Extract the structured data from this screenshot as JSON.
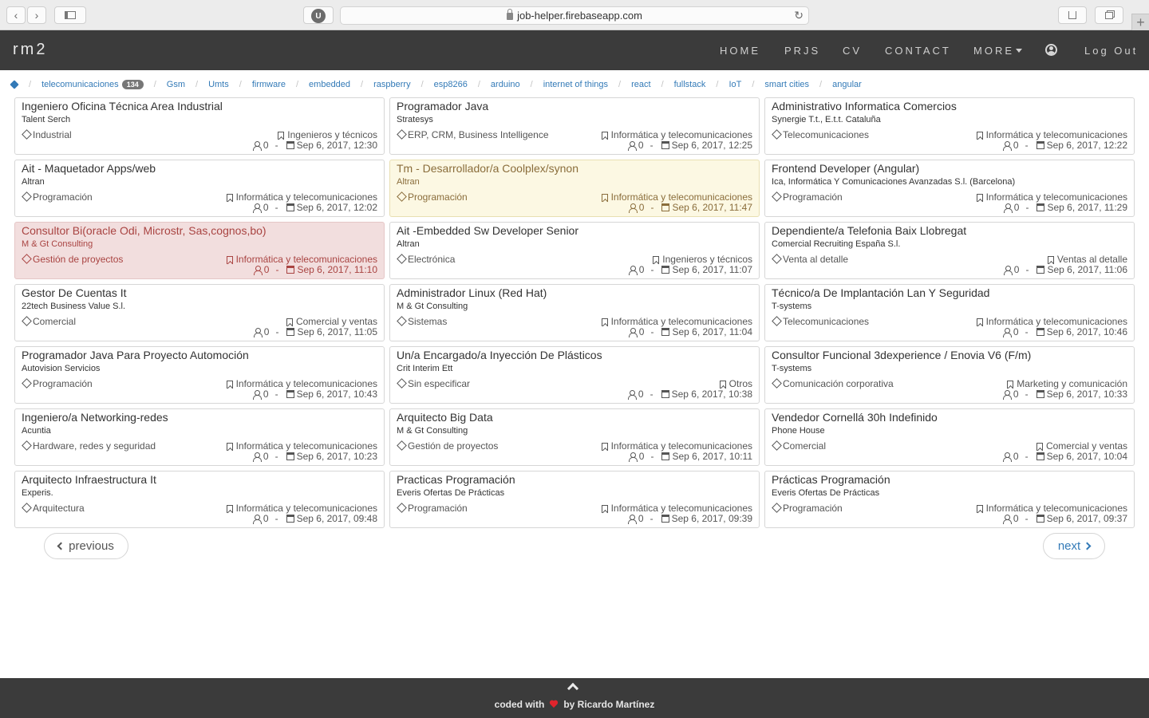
{
  "browser": {
    "url": "job-helper.firebaseapp.com",
    "ublock_label": "U",
    "back_glyph": "‹",
    "forward_glyph": "›",
    "newtab_glyph": "+"
  },
  "nav": {
    "brand": "rm2",
    "links": [
      "HOME",
      "PRJS",
      "CV",
      "CONTACT",
      "MORE"
    ],
    "logout": "Log Out"
  },
  "breadcrumb": {
    "items": [
      "telecomunicaciones",
      "Gsm",
      "Umts",
      "firmware",
      "embedded",
      "raspberry",
      "esp8266",
      "arduino",
      "internet of things",
      "react",
      "fullstack",
      "IoT",
      "smart cities",
      "angular"
    ],
    "count": "134"
  },
  "jobs": [
    {
      "title": "Ingeniero Oficina Técnica Area Industrial",
      "company": "Talent Serch",
      "area": "Industrial",
      "category": "Ingenieros y técnicos",
      "applicants": "0",
      "date": "Sep 6, 2017, 12:30",
      "status": "normal"
    },
    {
      "title": "Programador Java",
      "company": "Stratesys",
      "area": "ERP, CRM, Business Intelligence",
      "category": "Informática y telecomunicaciones",
      "applicants": "0",
      "date": "Sep 6, 2017, 12:25",
      "status": "normal"
    },
    {
      "title": "Administrativo Informatica Comercios",
      "company": "Synergie T.t., E.t.t. Cataluña",
      "area": "Telecomunicaciones",
      "category": "Informática y telecomunicaciones",
      "applicants": "0",
      "date": "Sep 6, 2017, 12:22",
      "status": "normal"
    },
    {
      "title": "Ait - Maquetador Apps/web",
      "company": "Altran",
      "area": "Programación",
      "category": "Informática y telecomunicaciones",
      "applicants": "0",
      "date": "Sep 6, 2017, 12:02",
      "status": "normal"
    },
    {
      "title": "Tm - Desarrollador/a Coolplex/synon",
      "company": "Altran",
      "area": "Programación",
      "category": "Informática y telecomunicaciones",
      "applicants": "0",
      "date": "Sep 6, 2017, 11:47",
      "status": "warning"
    },
    {
      "title": "Frontend Developer (Angular)",
      "company": "Ica, Informática Y Comunicaciones Avanzadas S.l. (Barcelona)",
      "area": "Programación",
      "category": "Informática y telecomunicaciones",
      "applicants": "0",
      "date": "Sep 6, 2017, 11:29",
      "status": "normal"
    },
    {
      "title": "Consultor Bi(oracle Odi, Microstr, Sas,cognos,bo)",
      "company": "M & Gt Consulting",
      "area": "Gestión de proyectos",
      "category": "Informática y telecomunicaciones",
      "applicants": "0",
      "date": "Sep 6, 2017, 11:10",
      "status": "danger"
    },
    {
      "title": "Ait -Embedded Sw Developer Senior",
      "company": "Altran",
      "area": "Electrónica",
      "category": "Ingenieros y técnicos",
      "applicants": "0",
      "date": "Sep 6, 2017, 11:07",
      "status": "normal"
    },
    {
      "title": "Dependiente/a Telefonia Baix Llobregat",
      "company": "Comercial Recruiting España S.l.",
      "area": "Venta al detalle",
      "category": "Ventas al detalle",
      "applicants": "0",
      "date": "Sep 6, 2017, 11:06",
      "status": "normal"
    },
    {
      "title": "Gestor De Cuentas It",
      "company": "22tech Business Value S.l.",
      "area": "Comercial",
      "category": "Comercial y ventas",
      "applicants": "0",
      "date": "Sep 6, 2017, 11:05",
      "status": "normal"
    },
    {
      "title": "Administrador Linux (Red Hat)",
      "company": "M & Gt Consulting",
      "area": "Sistemas",
      "category": "Informática y telecomunicaciones",
      "applicants": "0",
      "date": "Sep 6, 2017, 11:04",
      "status": "normal"
    },
    {
      "title": "Técnico/a De Implantación Lan Y Seguridad",
      "company": "T-systems",
      "area": "Telecomunicaciones",
      "category": "Informática y telecomunicaciones",
      "applicants": "0",
      "date": "Sep 6, 2017, 10:46",
      "status": "normal"
    },
    {
      "title": "Programador Java Para Proyecto Automoción",
      "company": "Autovision Servicios",
      "area": "Programación",
      "category": "Informática y telecomunicaciones",
      "applicants": "0",
      "date": "Sep 6, 2017, 10:43",
      "status": "normal"
    },
    {
      "title": "Un/a Encargado/a Inyección De Plásticos",
      "company": "Crit Interim Ett",
      "area": "Sin especificar",
      "category": "Otros",
      "applicants": "0",
      "date": "Sep 6, 2017, 10:38",
      "status": "normal"
    },
    {
      "title": "Consultor Funcional 3dexperience / Enovia V6 (F/m)",
      "company": "T-systems",
      "area": "Comunicación corporativa",
      "category": "Marketing y comunicación",
      "applicants": "0",
      "date": "Sep 6, 2017, 10:33",
      "status": "normal"
    },
    {
      "title": "Ingeniero/a Networking-redes",
      "company": "Acuntia",
      "area": "Hardware, redes y seguridad",
      "category": "Informática y telecomunicaciones",
      "applicants": "0",
      "date": "Sep 6, 2017, 10:23",
      "status": "normal"
    },
    {
      "title": "Arquitecto Big Data",
      "company": "M & Gt Consulting",
      "area": "Gestión de proyectos",
      "category": "Informática y telecomunicaciones",
      "applicants": "0",
      "date": "Sep 6, 2017, 10:11",
      "status": "normal"
    },
    {
      "title": "Vendedor Cornellá 30h Indefinido",
      "company": "Phone House",
      "area": "Comercial",
      "category": "Comercial y ventas",
      "applicants": "0",
      "date": "Sep 6, 2017, 10:04",
      "status": "normal"
    },
    {
      "title": "Arquitecto Infraestructura It",
      "company": "Experis.",
      "area": "Arquitectura",
      "category": "Informática y telecomunicaciones",
      "applicants": "0",
      "date": "Sep 6, 2017, 09:48",
      "status": "normal"
    },
    {
      "title": "Practicas Programación",
      "company": "Everis Ofertas De Prácticas",
      "area": "Programación",
      "category": "Informática y telecomunicaciones",
      "applicants": "0",
      "date": "Sep 6, 2017, 09:39",
      "status": "normal"
    },
    {
      "title": "Prácticas Programación",
      "company": "Everis Ofertas De Prácticas",
      "area": "Programación",
      "category": "Informática y telecomunicaciones",
      "applicants": "0",
      "date": "Sep 6, 2017, 09:37",
      "status": "normal"
    }
  ],
  "pager": {
    "previous": "previous",
    "next": "next"
  },
  "footer": {
    "prefix": "coded with",
    "suffix": "by Ricardo Martínez"
  },
  "colors": {
    "navbar": "#3b3b3b",
    "link": "#337ab7",
    "warning_bg": "#fcf8e3",
    "danger_bg": "#f2dede",
    "heart": "#e0242c"
  }
}
